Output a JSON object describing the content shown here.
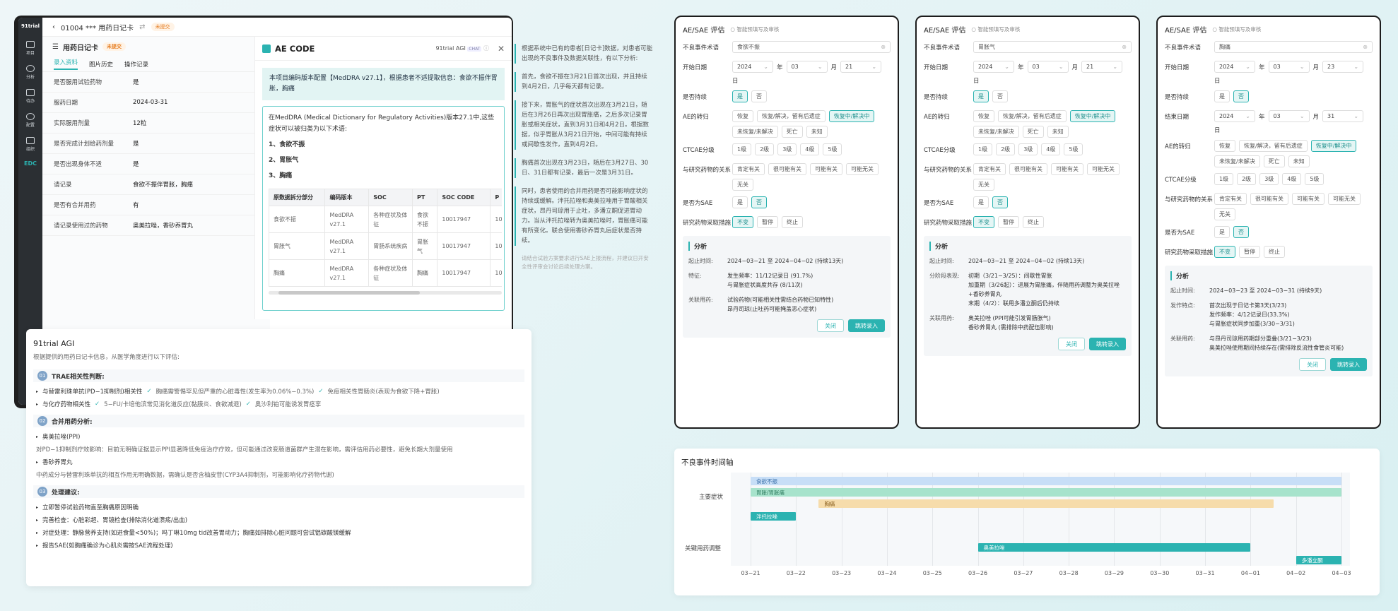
{
  "device": {
    "sidebar": {
      "logo": "91trial",
      "items": [
        {
          "label": "项目"
        },
        {
          "label": "分析"
        },
        {
          "label": "待办"
        },
        {
          "label": "配置"
        },
        {
          "label": "组织"
        }
      ],
      "edc": "EDC"
    },
    "topbar": {
      "title": "01004 *** 用药日记卡",
      "status": "未提交"
    },
    "left_panel": {
      "title": "用药日记卡",
      "status": "未提交",
      "tabs": [
        "录入资料",
        "图片历史",
        "操作记录"
      ],
      "fields": [
        {
          "k": "是否服用试验药物",
          "v": "是"
        },
        {
          "k": "服药日期",
          "v": "2024-03-31"
        },
        {
          "k": "实际服用剂量",
          "v": "12粒"
        },
        {
          "k": "是否完成计划给药剂量",
          "v": "是"
        },
        {
          "k": "是否出现身体不适",
          "v": "是"
        },
        {
          "k": "请记录",
          "v": "食欲不振伴胃胀，胸痛"
        },
        {
          "k": "是否有合并用药",
          "v": "有"
        },
        {
          "k": "请记录使用过的药物",
          "v": "奥美拉唑，香砂养胃丸"
        }
      ]
    },
    "ae_code": {
      "title": "AE CODE",
      "agi_label": "91trial AGI",
      "chat": "CHAT",
      "highlight": "本项目编码版本配置【MedDRA v27.1】，根据患者不适提取信息：食欲不振伴胃胀，胸痛",
      "intro": "在MedDRA (Medical Dictionary for Regulatory Activities)版本27.1中,这些症状可以被归类为以下术语:",
      "list": [
        "1、食欲不振",
        "2、胃胀气",
        "3、胸痛"
      ],
      "table": {
        "headers": [
          "原数据拆分部分",
          "编码版本",
          "SOC",
          "PT",
          "SOC CODE",
          "P"
        ],
        "rows": [
          [
            "食欲不振",
            "MedDRA v27.1",
            "各种症状及体征",
            "食欲不振",
            "10017947",
            "10"
          ],
          [
            "胃胀气",
            "MedDRA v27.1",
            "胃肠系统疾病",
            "胃胀气",
            "10017947",
            "10"
          ],
          [
            "胸痛",
            "MedDRA v27.1",
            "各种症状及体征",
            "胸痛",
            "10017947",
            "10"
          ]
        ]
      }
    }
  },
  "notes": [
    "根据系统中已有的患者[日记卡]数据，对患者可能出现的不良事件及数据关联性，有以下分析:",
    "首先，食欲不振在3月21日首次出现，并且持续到4月2日，几乎每天都有记录。",
    "接下来，胃胀气的症状首次出现在3月21日，随后在3月26日再次出现胃胀痛，之后多次记录胃胀或相关症状，直到3月31日和4月2日。根据数据，似乎胃胀从3月21日开始，中间可能有持续或间歇性发作，直到4月2日。",
    "胸痛首次出现在3月23日，随后在3月27日、30日、31日都有记录，最后一次是3月31日。",
    "同时，患者使用的合并用药是否可能影响症状的持续或缓解。泮托拉唑和奥美拉唑用于胃酸相关症状，昂丹司琼用于止吐，多潘立酮促进胃动力。当从泮托拉唑转为奥美拉唑时，胃胀痛可能有所变化。联合使用香砂养胃丸后症状是否持续。"
  ],
  "notes_foot": "请结合试验方案要求进行SAE上报流程，并建议日开安全性评审会讨论后续处理方案。",
  "agi": {
    "title": "91trial AGI",
    "subtitle": "根据提供的用药日记卡信息，从医学角度进行以下评估:",
    "s1": {
      "num": "01",
      "title": "TRAE相关性判断:"
    },
    "s1_line1": {
      "a": "与替雷利珠单抗(PD−1抑制剂)相关性",
      "b": "胸痛需警惕罕见但严重的心脏毒性(发生率为0.06%−0.3%)",
      "c": "免疫相关性胃肠炎(表现为食欲下降+胃胀)"
    },
    "s1_line2": {
      "a": "与化疗药物相关性",
      "b": "5−FU/卡培他滨常见消化道反应(黏膜炎、食欲减退)",
      "c": "奥沙利铂可能诱发胃痉挛"
    },
    "s2": {
      "num": "02",
      "title": "合并用药分析:"
    },
    "s2_a": "奥美拉唑(PPI)",
    "s2_a_desc": "对PD−1抑制剂疗效影响：目前无明确证据显示PPI显著降低免疫治疗疗效，但可能通过改变肠道菌群产生潜在影响，需评估用药必要性，避免长期大剂量使用",
    "s2_b": "香砂养胃丸",
    "s2_b_desc": "中药成分与替雷利珠单抗的相互作用无明确数据，需确认是否含柚皮苷(CYP3A4抑制剂，可能影响化疗药物代谢)",
    "s3": {
      "num": "03",
      "title": "处理建议:"
    },
    "s3_items": [
      "立即暂停试验药物直至胸痛原因明确",
      "完善检查：心脏彩超、胃镜检查(排除消化道溃疡/出血)",
      "对症处理：静脉营养支持(如进食量<50%)；吗丁啉10mg tid改善胃动力；胸痛如排除心脏问题可尝试铝碳酸镁缓解",
      "报告SAE(如胸痛确诊为心肌炎需按SAE流程处理)"
    ]
  },
  "cards": [
    {
      "title": "AE/SAE 评估",
      "smart": "智能预填写及审核",
      "term_label": "不良事件术语",
      "term": "食欲不振",
      "start_label": "开始日期",
      "start": {
        "y": "2024",
        "m": "03",
        "d": "21"
      },
      "ongoing_label": "是否持续",
      "ongoing": [
        "是",
        "否"
      ],
      "outcome_label": "AE的转归",
      "outcome": [
        "恢复",
        "恢复/解决，留有后遗症",
        "恢复中/解决中",
        "未恢复/未解决",
        "死亡",
        "未知"
      ],
      "ctcae_label": "CTCAE分级",
      "ctcae": [
        "1级",
        "2级",
        "3级",
        "4级",
        "5级"
      ],
      "rel_label": "与研究药物的关系",
      "rel": [
        "肯定有关",
        "很可能有关",
        "可能有关",
        "可能无关",
        "无关"
      ],
      "sae_label": "是否为SAE",
      "sae": [
        "是",
        "否"
      ],
      "measure_label": "研究药物采取措施",
      "measure": [
        "不变",
        "暂停",
        "终止"
      ],
      "analysis_title": "分析",
      "analysis": [
        {
          "k": "起止时间:",
          "v": "2024−03−21 至 2024−04−02 (持续13天)"
        },
        {
          "k": "特征:",
          "v": "发生频率：11/12记录日 (91.7%)\n与胃胀症状高度共存 (8/11次)"
        },
        {
          "k": "关联用药:",
          "v": "试验药物(可能相关性需结合药物已知特性)\n昂丹司琼(止吐药可能掩盖恶心症状)"
        }
      ],
      "close": "关闭",
      "jump": "跳转录入"
    },
    {
      "title": "AE/SAE 评估",
      "smart": "智能预填写及审核",
      "term_label": "不良事件术语",
      "term": "胃胀气",
      "start_label": "开始日期",
      "start": {
        "y": "2024",
        "m": "03",
        "d": "21"
      },
      "ongoing_label": "是否持续",
      "ongoing": [
        "是",
        "否"
      ],
      "outcome_label": "AE的转归",
      "outcome": [
        "恢复",
        "恢复/解决，留有后遗症",
        "恢复中/解决中",
        "未恢复/未解决",
        "死亡",
        "未知"
      ],
      "ctcae_label": "CTCAE分级",
      "ctcae": [
        "1级",
        "2级",
        "3级",
        "4级",
        "5级"
      ],
      "rel_label": "与研究药物的关系",
      "rel": [
        "肯定有关",
        "很可能有关",
        "可能有关",
        "可能无关",
        "无关"
      ],
      "sae_label": "是否为SAE",
      "sae": [
        "是",
        "否"
      ],
      "measure_label": "研究药物采取措施",
      "measure": [
        "不变",
        "暂停",
        "终止"
      ],
      "analysis_title": "分析",
      "analysis": [
        {
          "k": "起止时间:",
          "v": "2024−03−21 至 2024−04−02 (持续13天)"
        },
        {
          "k": "分阶段表现:",
          "v": "初期（3/21−3/25）：间歇性胃胀\n加重期（3/26起）：进展为胃胀痛，伴随用药调整为奥美拉唑+香砂养胃丸\n末期（4/2）：联用多潘立酮后仍持续"
        },
        {
          "k": "关联用药:",
          "v": "奥美拉唑 (PPI可能引发胃肠胀气)\n香砂养胃丸 (需排除中药配伍影响)"
        }
      ],
      "close": "关闭",
      "jump": "跳转录入"
    },
    {
      "title": "AE/SAE 评估",
      "smart": "智能预填写及审核",
      "term_label": "不良事件术语",
      "term": "胸痛",
      "start_label": "开始日期",
      "start": {
        "y": "2024",
        "m": "03",
        "d": "23"
      },
      "ongoing_label": "是否持续",
      "ongoing": [
        "是",
        "否"
      ],
      "end_label": "结束日期",
      "end": {
        "y": "2024",
        "m": "03",
        "d": "31"
      },
      "outcome_label": "AE的转归",
      "outcome": [
        "恢复",
        "恢复/解决，留有后遗症",
        "恢复中/解决中",
        "未恢复/未解决",
        "死亡",
        "未知"
      ],
      "ctcae_label": "CTCAE分级",
      "ctcae": [
        "1级",
        "2级",
        "3级",
        "4级",
        "5级"
      ],
      "rel_label": "与研究药物的关系",
      "rel": [
        "肯定有关",
        "很可能有关",
        "可能有关",
        "可能无关",
        "无关"
      ],
      "sae_label": "是否为SAE",
      "sae": [
        "是",
        "否"
      ],
      "measure_label": "研究药物采取措施",
      "measure": [
        "不变",
        "暂停",
        "终止"
      ],
      "analysis_title": "分析",
      "analysis": [
        {
          "k": "起止时间:",
          "v": "2024−03−23 至 2024−03−31 (持续9天)"
        },
        {
          "k": "发作特点:",
          "v": "首次出现于日记卡第3天(3/23)\n发作频率：4/12记录日(33.3%)\n与胃胀症状同步加重(3/30−3/31)"
        },
        {
          "k": "关联用药:",
          "v": "与昂丹司琼用药期部分重叠(3/21−3/23)\n奥美拉唑使用期间持续存在(需排除反流性食管炎可能)"
        }
      ],
      "close": "关闭",
      "jump": "跳转录入"
    }
  ],
  "units": {
    "year": "年",
    "month": "月",
    "day": "日"
  },
  "timeline": {
    "title": "不良事件时间轴",
    "categories": [
      "主要症状",
      "关键用药调整"
    ],
    "ticks": [
      "03−21",
      "03−22",
      "03−23",
      "03−24",
      "03−25",
      "03−26",
      "03−27",
      "03−28",
      "03−29",
      "03−30",
      "03−31",
      "04−01",
      "04−02",
      "04−03"
    ],
    "bars": [
      {
        "label": "食欲不振",
        "start": 0,
        "end": 13,
        "color": "#c7def7",
        "text": "#3a6fa8",
        "row": 0
      },
      {
        "label": "胃胀/胃胀痛",
        "start": 0,
        "end": 13,
        "color": "#a7e3cc",
        "text": "#2f7d60",
        "row": 1
      },
      {
        "label": "胸痛",
        "start": 1.5,
        "end": 11.5,
        "color": "#f6dcab",
        "text": "#8a6020",
        "row": 2
      },
      {
        "label": "泮托拉唑",
        "start": 0,
        "end": 1,
        "color": "#2bb3b1",
        "text": "#ffffff",
        "row": 4
      },
      {
        "label": "奥美拉唑",
        "start": 5,
        "end": 11,
        "color": "#2bb3b1",
        "text": "#ffffff",
        "row": 5
      },
      {
        "label": "多潘立酮",
        "start": 12,
        "end": 13,
        "color": "#2bb3b1",
        "text": "#ffffff",
        "row": 6
      }
    ]
  }
}
